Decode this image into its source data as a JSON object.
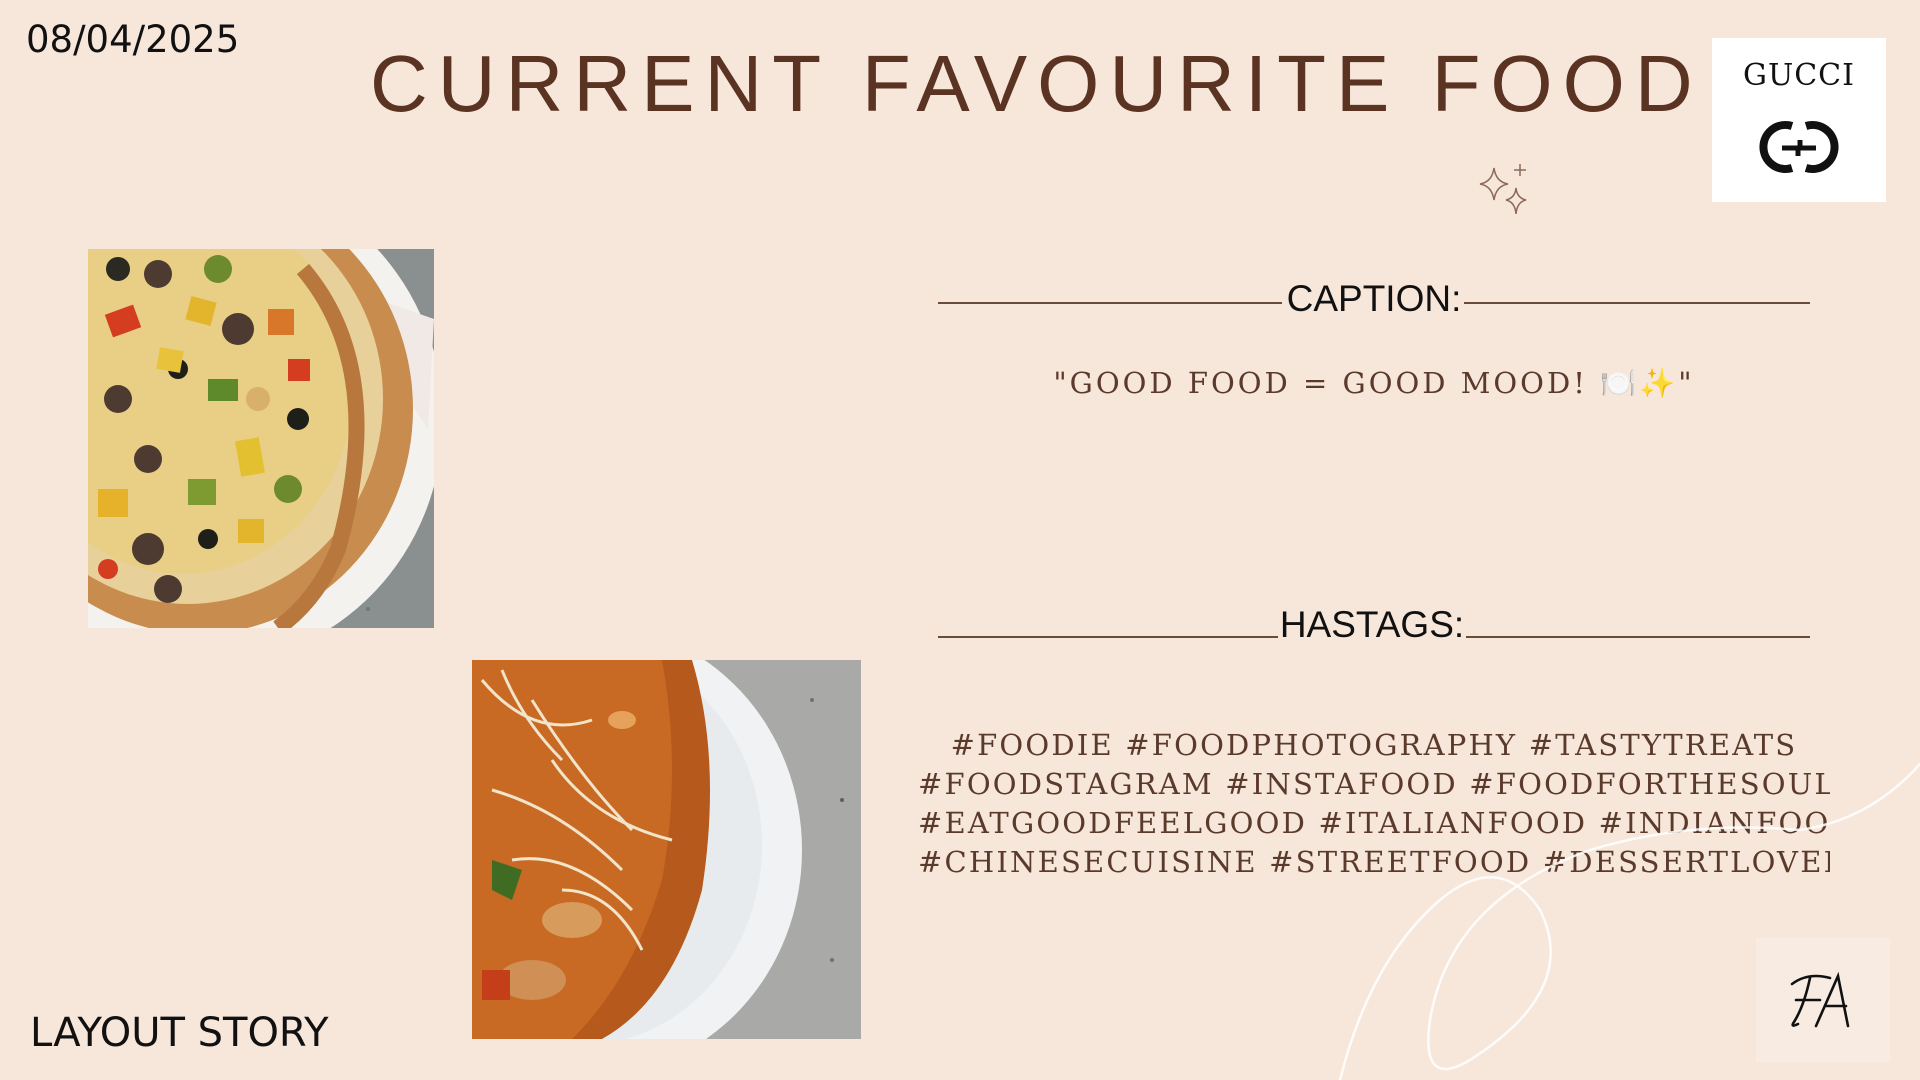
{
  "slide": {
    "date": "08/04/2025",
    "title": "CURRENT FAVOURITE FOOD",
    "caption_heading": "CAPTION:",
    "caption_text": "\"GOOD FOOD = GOOD MOOD! 🍽️✨\"",
    "hashtags_heading": "HASTAGS:",
    "hashtag_lines": [
      "#FOODIE   #FOODPHOTOGRAPHY  #TASTYTREATS",
      "#FOODSTAGRAM #INSTAFOOD #FOODFORTHESOUL",
      "#EATGOODFEELGOOD #ITALIANFOOD #INDIANFOOD",
      "#CHINESECUISINE #STREETFOOD #DESSERTLOVER"
    ],
    "footer_label": "LAYOUT STORY"
  },
  "logos": {
    "brand_wordmark": "GUCCI",
    "brand_icon": "gucci-gg-icon",
    "signature_icon": "fa-monogram-signature"
  },
  "photos": {
    "pizza": "pizza-photo",
    "curry": "pasta-curry-photo"
  },
  "colors": {
    "background": "#f7e6da",
    "title": "#5a3323",
    "body_text": "#5a3a2b",
    "rule": "#6a4a3a"
  }
}
